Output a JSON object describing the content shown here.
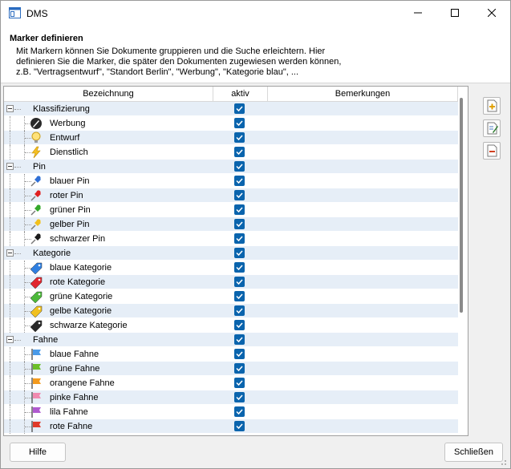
{
  "window": {
    "title": "DMS"
  },
  "header": {
    "title": "Marker definieren",
    "description_lines": [
      "Mit Markern können Sie Dokumente gruppieren und die Suche erleichtern. Hier",
      "definieren Sie die Marker, die später den Dokumenten zugewiesen werden können,",
      "z.B. \"Vertragsentwurf\", \"Standort Berlin\", \"Werbung\", \"Kategorie blau\", ..."
    ]
  },
  "grid": {
    "columns": [
      "Bezeichnung",
      "aktiv",
      "Bemerkungen"
    ],
    "rows": [
      {
        "type": "group",
        "label": "Klassifizierung",
        "active": true,
        "remarks": ""
      },
      {
        "type": "item",
        "label": "Werbung",
        "icon": "pen-nib-icon",
        "active": true,
        "remarks": ""
      },
      {
        "type": "item",
        "label": "Entwurf",
        "icon": "lightbulb-icon",
        "active": true,
        "remarks": ""
      },
      {
        "type": "item",
        "label": "Dienstlich",
        "icon": "lightning-icon",
        "active": true,
        "remarks": ""
      },
      {
        "type": "group",
        "label": "Pin",
        "active": true,
        "remarks": ""
      },
      {
        "type": "item",
        "label": "blauer Pin",
        "icon": "pin-icon",
        "color": "#2f6fd6",
        "active": true,
        "remarks": ""
      },
      {
        "type": "item",
        "label": "roter Pin",
        "icon": "pin-icon",
        "color": "#e02020",
        "active": true,
        "remarks": ""
      },
      {
        "type": "item",
        "label": "grüner Pin",
        "icon": "pin-icon",
        "color": "#34a82a",
        "active": true,
        "remarks": ""
      },
      {
        "type": "item",
        "label": "gelber Pin",
        "icon": "pin-icon",
        "color": "#f2c01c",
        "active": true,
        "remarks": ""
      },
      {
        "type": "item",
        "label": "schwarzer Pin",
        "icon": "pin-icon",
        "color": "#1a1a1a",
        "active": true,
        "remarks": ""
      },
      {
        "type": "group",
        "label": "Kategorie",
        "active": true,
        "remarks": ""
      },
      {
        "type": "item",
        "label": "blaue Kategorie",
        "icon": "tag-icon",
        "color": "#2f7fe0",
        "active": true,
        "remarks": ""
      },
      {
        "type": "item",
        "label": "rote Kategorie",
        "icon": "tag-icon",
        "color": "#e0262e",
        "active": true,
        "remarks": ""
      },
      {
        "type": "item",
        "label": "grüne Kategorie",
        "icon": "tag-icon",
        "color": "#4cb83a",
        "active": true,
        "remarks": ""
      },
      {
        "type": "item",
        "label": "gelbe Kategorie",
        "icon": "tag-icon",
        "color": "#f0c020",
        "active": true,
        "remarks": ""
      },
      {
        "type": "item",
        "label": "schwarze Kategorie",
        "icon": "tag-icon",
        "color": "#2a2a2a",
        "active": true,
        "remarks": ""
      },
      {
        "type": "group",
        "label": "Fahne",
        "active": true,
        "remarks": ""
      },
      {
        "type": "item",
        "label": "blaue Fahne",
        "icon": "flag-icon",
        "color": "#4a9ae8",
        "active": true,
        "remarks": ""
      },
      {
        "type": "item",
        "label": "grüne Fahne",
        "icon": "flag-icon",
        "color": "#6cbf2a",
        "active": true,
        "remarks": ""
      },
      {
        "type": "item",
        "label": "orangene Fahne",
        "icon": "flag-icon",
        "color": "#f39a1e",
        "active": true,
        "remarks": ""
      },
      {
        "type": "item",
        "label": "pinke Fahne",
        "icon": "flag-icon",
        "color": "#f08ab0",
        "active": true,
        "remarks": ""
      },
      {
        "type": "item",
        "label": "lila Fahne",
        "icon": "flag-icon",
        "color": "#b05ad0",
        "active": true,
        "remarks": ""
      },
      {
        "type": "item",
        "label": "rote Fahne",
        "icon": "flag-icon",
        "color": "#e03a2a",
        "active": true,
        "remarks": ""
      }
    ]
  },
  "side_buttons": [
    "add-marker-icon",
    "edit-marker-icon",
    "remove-marker-icon"
  ],
  "footer": {
    "help_label": "Hilfe",
    "close_label": "Schließen"
  },
  "colors": {
    "accent": "#0a64ad",
    "row_alt": "#e6eef7"
  }
}
